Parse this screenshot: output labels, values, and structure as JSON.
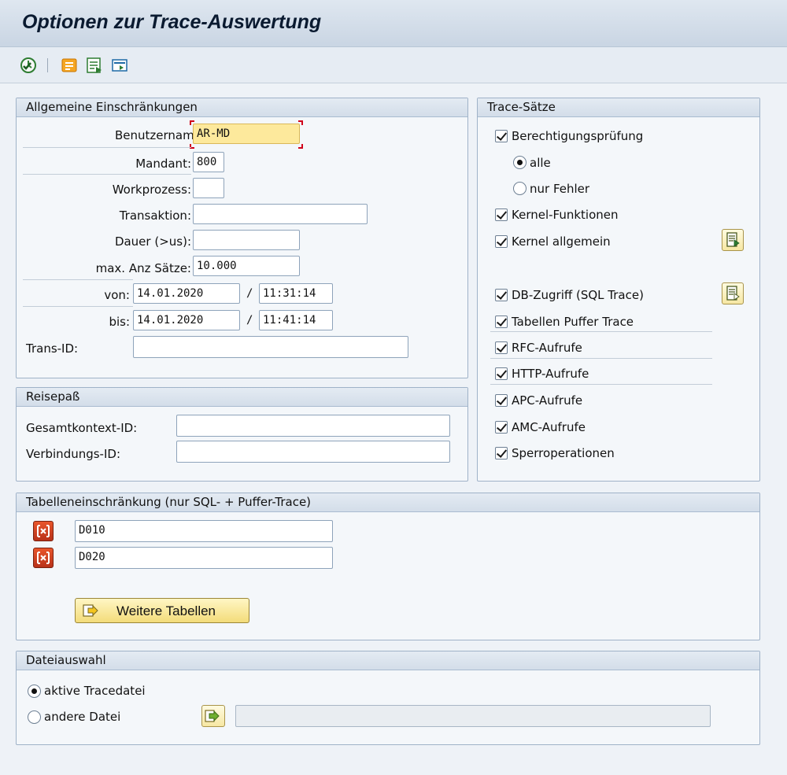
{
  "title": "Optionen zur Trace-Auswertung",
  "toolbar": {
    "icons": [
      "execute-icon",
      "filter-icon",
      "display-icon",
      "settings-icon"
    ]
  },
  "allgemein": {
    "header": "Allgemeine Einschränkungen",
    "benutzername_label": "Benutzername:",
    "benutzername_value": "AR-MD",
    "mandant_label": "Mandant:",
    "mandant_value": "800",
    "workprozess_label": "Workprozess:",
    "workprozess_value": "",
    "transaktion_label": "Transaktion:",
    "transaktion_value": "",
    "dauer_label": "Dauer (>us):",
    "dauer_value": "",
    "max_label": "max. Anz Sätze:",
    "max_value": "10.000",
    "von_label": "von:",
    "von_date": "14.01.2020",
    "von_time": "11:31:14",
    "bis_label": "bis:",
    "bis_date": "14.01.2020",
    "bis_time": "11:41:14",
    "slash": "/",
    "transid_label": "Trans-ID:",
    "transid_value": ""
  },
  "reisepass": {
    "header": "Reisepaß",
    "gesamt_label": "Gesamtkontext-ID:",
    "gesamt_value": "",
    "verbindung_label": "Verbindungs-ID:",
    "verbindung_value": ""
  },
  "trace_saetze": {
    "header": "Trace-Sätze",
    "berechtigung": "Berechtigungsprüfung",
    "alle": "alle",
    "nur_fehler": "nur Fehler",
    "kernel_funktionen": "Kernel-Funktionen",
    "kernel_allgemein": "Kernel allgemein",
    "db_zugriff": "DB-Zugriff (SQL Trace)",
    "tabellen_puffer": "Tabellen Puffer Trace",
    "rfc": "RFC-Aufrufe",
    "http": "HTTP-Aufrufe",
    "apc": "APC-Aufrufe",
    "amc": "AMC-Aufrufe",
    "sperr": "Sperroperationen"
  },
  "tabellen": {
    "header": "Tabelleneinschränkung (nur SQL- + Puffer-Trace)",
    "rows": [
      "D010",
      "D020"
    ],
    "weitere_label": "Weitere Tabellen"
  },
  "datei": {
    "header": "Dateiauswahl",
    "aktive": "aktive Tracedatei",
    "andere": "andere Datei",
    "andere_value": ""
  },
  "colors": {
    "focus_field": "#fde99c",
    "group_border": "#9fb2c8",
    "title_text": "#0a1a30"
  }
}
